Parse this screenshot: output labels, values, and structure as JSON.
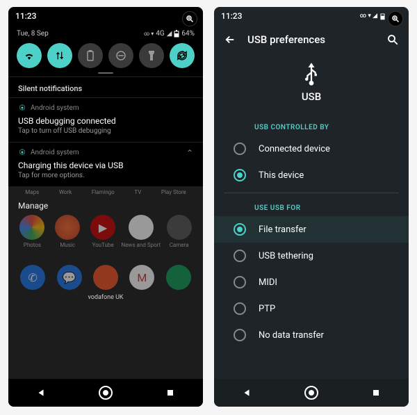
{
  "left": {
    "status": {
      "time": "11:23",
      "battery": "64%",
      "network": "4G"
    },
    "date": "Tue, 8 Sep",
    "tiles": [
      "wifi",
      "data",
      "battery",
      "dnd",
      "flashlight",
      "rotate"
    ],
    "silent_header": "Silent notifications",
    "notif1": {
      "app": "Android system",
      "title": "USB debugging connected",
      "sub": "Tap to turn off USB debugging"
    },
    "notif2": {
      "app": "Android system",
      "title": "Charging this device via USB",
      "sub": "Tap for more options."
    },
    "ghost_row": [
      "Maps",
      "Work",
      "Flamingo",
      "TV",
      "Play Store"
    ],
    "manage": "Manage",
    "apps_row1": [
      "Photos",
      "Music",
      "YouTube",
      "News and Sport",
      "Camera"
    ],
    "carrier": "vodafone UK"
  },
  "right": {
    "status": {
      "time": "11:23"
    },
    "header": "USB preferences",
    "usb_title": "USB",
    "section1": "USB CONTROLLED BY",
    "opts1": [
      {
        "label": "Connected device",
        "on": false
      },
      {
        "label": "This device",
        "on": true
      }
    ],
    "section2": "USE USB FOR",
    "opts2": [
      {
        "label": "File transfer",
        "on": true
      },
      {
        "label": "USB tethering",
        "on": false
      },
      {
        "label": "MIDI",
        "on": false
      },
      {
        "label": "PTP",
        "on": false
      },
      {
        "label": "No data transfer",
        "on": false
      }
    ]
  }
}
